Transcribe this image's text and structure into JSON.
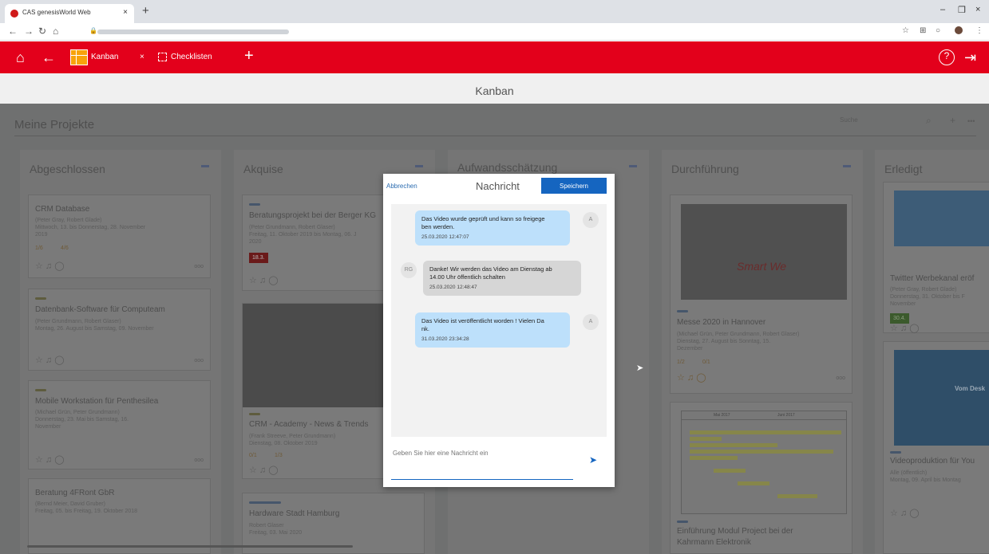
{
  "browser": {
    "tab_title": "CAS genesisWorld Web",
    "tab_close": "×",
    "new_tab": "+",
    "url": "",
    "min": "–",
    "max": "❐",
    "close": "×"
  },
  "appbar": {
    "tabs": [
      {
        "label": "Kanban"
      },
      {
        "label": "Checklisten"
      }
    ],
    "close_tab": "×",
    "add_tab": "+"
  },
  "page_title": "Kanban",
  "project": {
    "title": "Meine Projekte",
    "search_placeholder": "Suche"
  },
  "columns": [
    {
      "title": "Abgeschlossen",
      "cards": [
        {
          "title": "CRM Database",
          "sub": "(Peter Gray, Robert Glade)",
          "date": "Mittwoch, 13. bis Donnerstag, 28. November",
          "year": "2019",
          "progress": "1/6",
          "tasks": "4/6"
        },
        {
          "title": "Datenbank-Software für Computeam",
          "sub": "(Peter Grundmann, Robert Glaser)",
          "date": "Montag, 26. August  bis Samstag, 09. November"
        },
        {
          "title": "Mobile Workstation für Penthesilea",
          "sub": "(Michael Grün, Peter Grundmann)",
          "date": "Donnerstag, 23. Mai  bis Samstag, 16.",
          "date2": "November"
        },
        {
          "title": "Beratung 4FRont GbR",
          "sub": "(Bernd Meier, David Gruber)",
          "date": "Freitag, 05. bis Freitag, 19. Oktober 2018"
        }
      ]
    },
    {
      "title": "Akquise",
      "cards": [
        {
          "title": "Beratungsprojekt bei der Berger KG",
          "sub": "(Peter Grundmann, Robert Glaser)",
          "date": "Freitag, 11. Oktober 2019  bis Montag, 06. J",
          "year": "2020",
          "badge": "18.3."
        },
        {
          "title": "CRM - Academy - News & Trends",
          "sub": "(Frank Streeve, Peter Grundmann)",
          "date": "Dienstag, 08. Oktober 2019",
          "progress": "0/1",
          "tasks": "1/3"
        },
        {
          "title": "Hardware Stadt Hamburg",
          "sub": "Robert Glaser",
          "date": "Freitag, 03. Mai 2020"
        }
      ]
    },
    {
      "title": "Aufwandsschätzung",
      "cards": []
    },
    {
      "title": "Durchführung",
      "cards": [
        {
          "title": "Messe 2020 in Hannover",
          "sub": "(Michael Grün, Peter Grundmann, Robert Glaser)",
          "date": "Dienstag, 27. August  bis Sonntag, 15.",
          "date2": "Dezember",
          "progress": "1/2",
          "tasks": "0/1"
        },
        {
          "title": "Einführung Modul Project bei der",
          "title2": "Kahrmann Elektronik"
        }
      ]
    },
    {
      "title": "Erledigt",
      "cards": [
        {
          "title": "Twitter Werbekanal eröf",
          "sub": "(Peter Gray, Robert Glade)",
          "date": "Donnerstag, 31. Oktober  bis F",
          "date2": "November",
          "badge": "30.4."
        },
        {
          "title": "Videoproduktion für You",
          "sub": "Alle (öffentlich)",
          "date": "Montag, 09. April  bis Montag"
        }
      ]
    }
  ],
  "modal": {
    "cancel": "Abbrechen",
    "title": "Nachricht",
    "save": "Speichern",
    "messages": [
      {
        "avatar": "A",
        "text1": "Das Video wurde geprüft und kann so freigege",
        "text2": "ben werden.",
        "time": "25.03.2020 12:47:07"
      },
      {
        "avatar": "RG",
        "text1": "Danke! Wir werden das Video am Dienstag ab",
        "text2": "14.00 Uhr öffentlich schalten",
        "time": "25.03.2020 12:48:47"
      },
      {
        "avatar": "A",
        "text1": "Das Video ist veröffentlicht worden ! Vielen Da",
        "text2": "nk.",
        "time": "31.03.2020 23:34:28"
      }
    ],
    "input_placeholder": "Geben Sie hier eine Nachricht ein"
  },
  "images": {
    "smart_text": "Smart We",
    "video_text": "Vom Desk",
    "gantt_months": [
      "Mai 2017",
      "Juni 2017"
    ]
  },
  "colors": {
    "accent": "#e3001b",
    "primary": "#1565c0",
    "bubble_mine": "#bde0fb",
    "bubble_theirs": "#d6d6d6"
  }
}
